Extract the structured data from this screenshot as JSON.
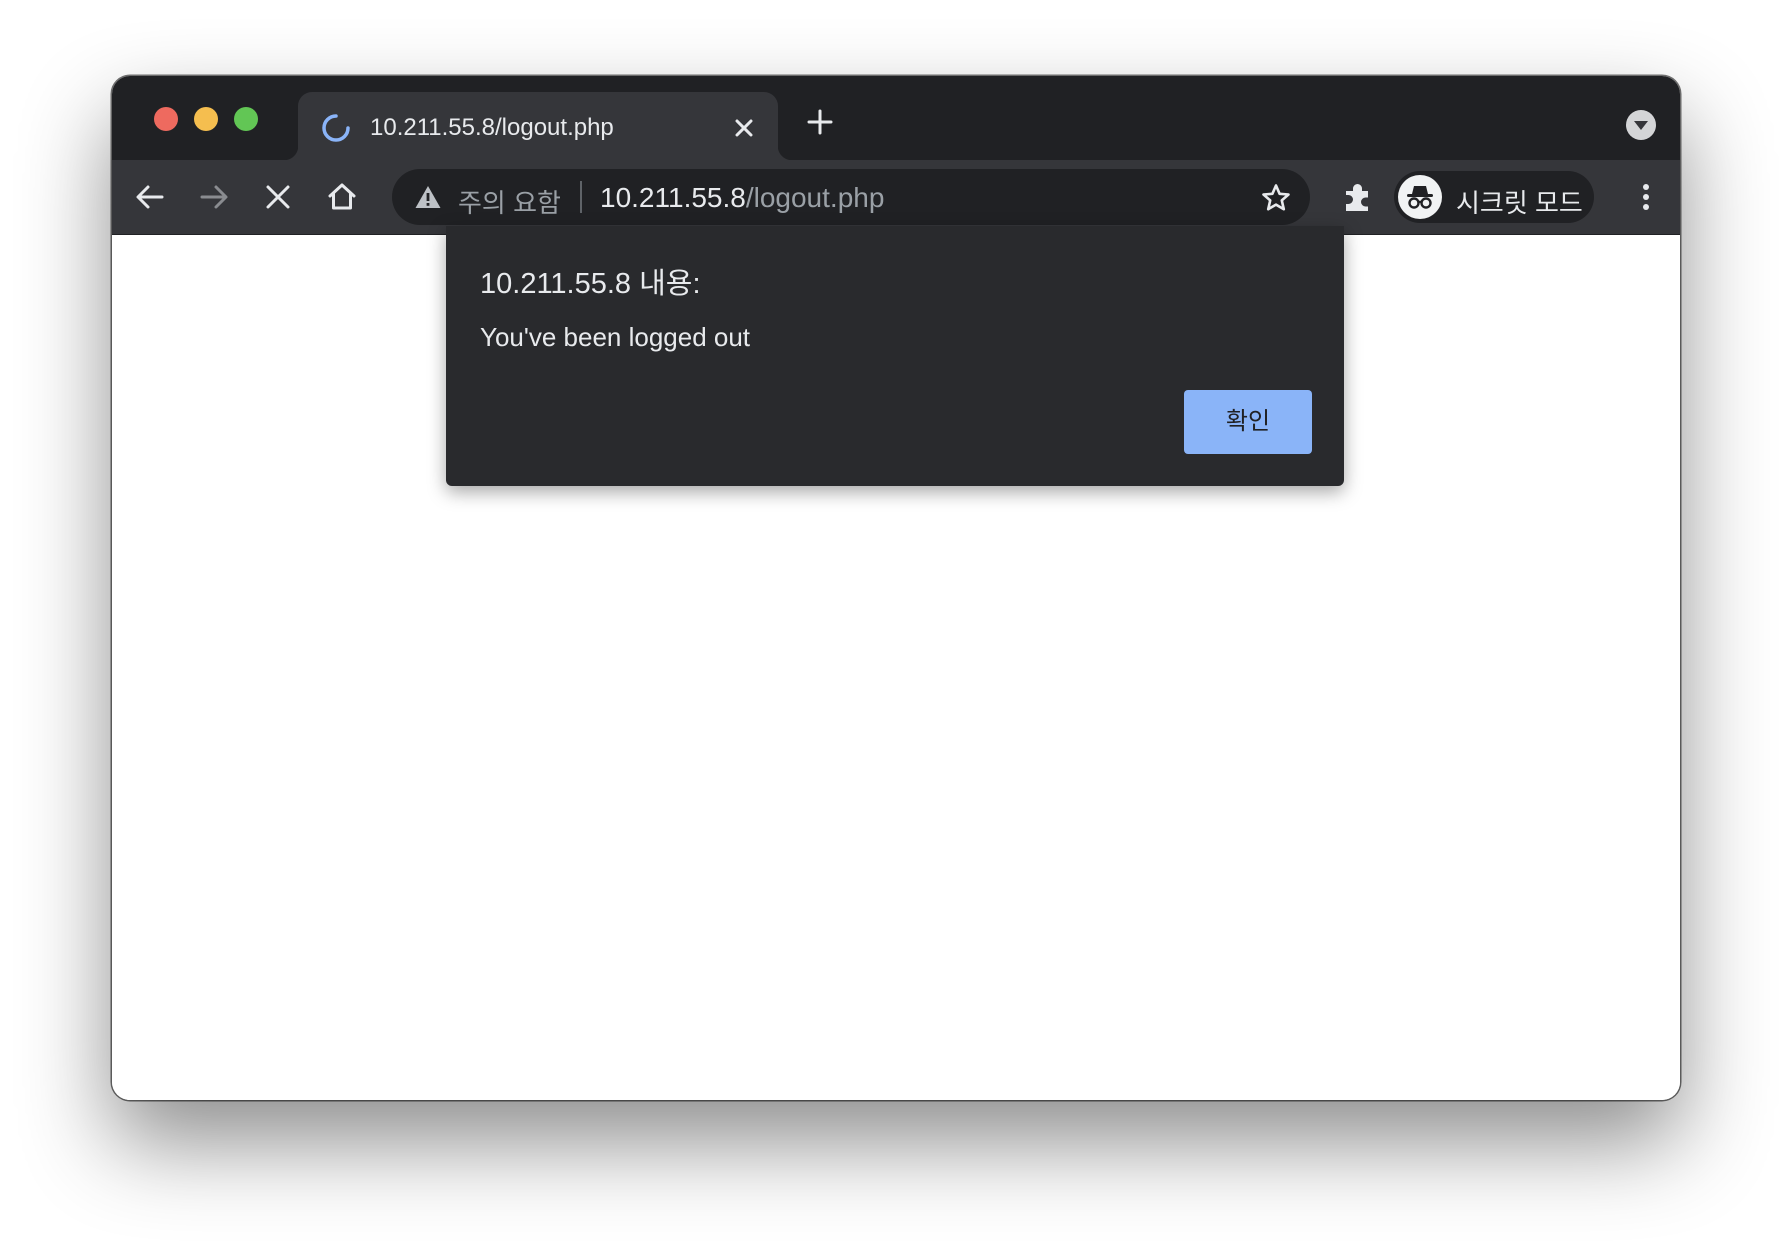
{
  "tab": {
    "title": "10.211.55.8/logout.php"
  },
  "omnibox": {
    "security_label": "주의 요함",
    "url_host": "10.211.55.8",
    "url_path": "/logout.php"
  },
  "profile": {
    "label": "시크릿 모드"
  },
  "dialog": {
    "title": "10.211.55.8 내용:",
    "message": "You've been logged out",
    "ok_label": "확인"
  },
  "icons": {
    "tab_loading": "loading-spinner-icon",
    "tab_close": "close-icon",
    "new_tab": "plus-icon",
    "tab_search": "chevron-down-icon",
    "back": "arrow-left-icon",
    "forward": "arrow-right-icon",
    "stop": "close-icon",
    "home": "home-icon",
    "security": "warning-triangle-icon",
    "bookmark": "star-icon",
    "extensions": "puzzle-icon",
    "incognito": "incognito-icon",
    "menu": "kebab-menu-icon"
  },
  "colors": {
    "frame": "#202124",
    "toolbar": "#35363a",
    "dialog_bg": "#292a2d",
    "button_accent": "#8ab4f8",
    "spinner": "#8ab4f8"
  }
}
